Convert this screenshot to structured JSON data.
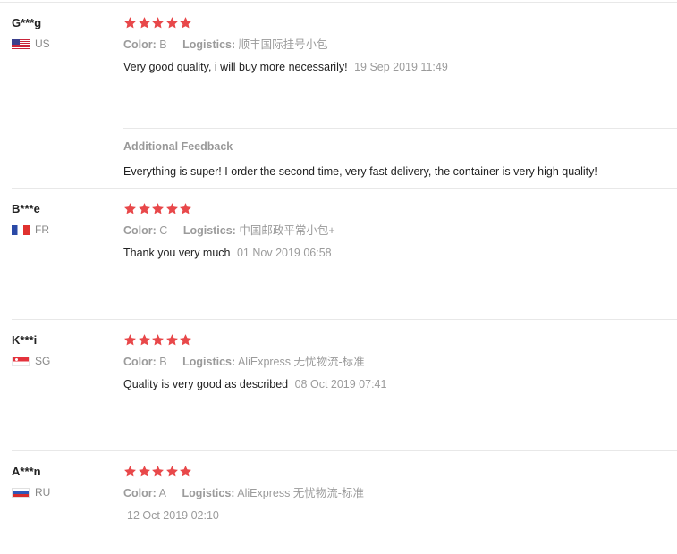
{
  "labels": {
    "color": "Color:",
    "logistics": "Logistics:",
    "additional_feedback": "Additional Feedback"
  },
  "colors": {
    "star": "#e8484a",
    "muted": "#999999",
    "divider": "#e8e8e8"
  },
  "reviews": [
    {
      "user": "G***g",
      "country": "US",
      "flag": "us-flag-icon",
      "rating": 5,
      "color": "B",
      "logistics": "顺丰国际挂号小包",
      "text": "Very good quality, i will buy more necessarily!",
      "date": "19 Sep 2019 11:49",
      "additional_feedback": "Everything is super! I order the second time, very fast delivery, the container is very high quality!"
    },
    {
      "user": "B***e",
      "country": "FR",
      "flag": "fr-flag-icon",
      "rating": 5,
      "color": "C",
      "logistics": "中国邮政平常小包+",
      "text": "Thank you very much",
      "date": "01 Nov 2019 06:58"
    },
    {
      "user": "K***i",
      "country": "SG",
      "flag": "sg-flag-icon",
      "rating": 5,
      "color": "B",
      "logistics": "AliExpress 无忧物流-标准",
      "text": "Quality is very good as described",
      "date": "08 Oct 2019 07:41"
    },
    {
      "user": "A***n",
      "country": "RU",
      "flag": "ru-flag-icon",
      "rating": 5,
      "color": "A",
      "logistics": "AliExpress 无忧物流-标准",
      "text": "",
      "date": "12 Oct 2019 02:10"
    }
  ]
}
